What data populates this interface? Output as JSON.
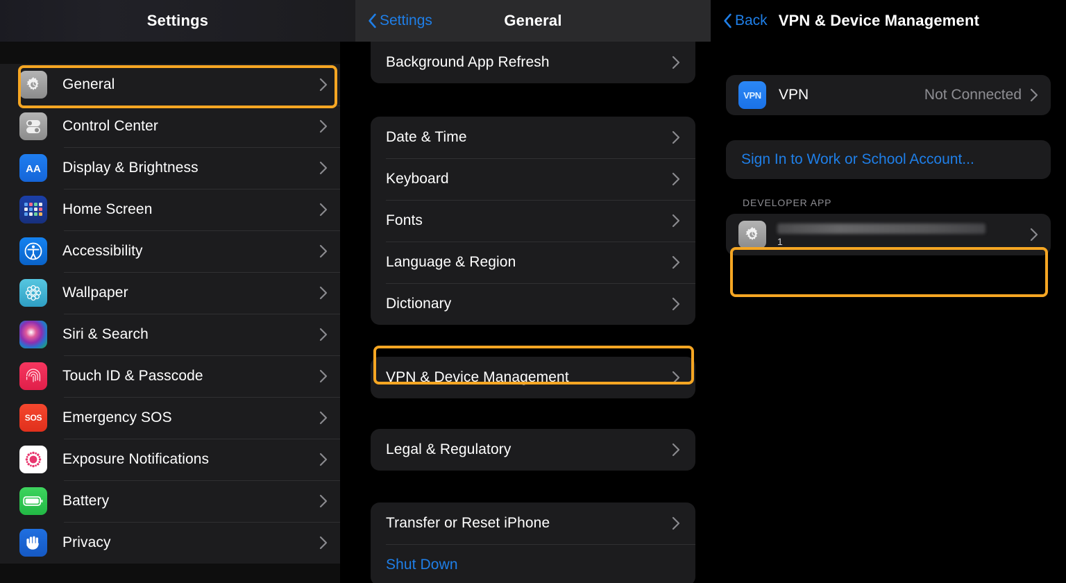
{
  "sidebar": {
    "title": "Settings",
    "items": [
      {
        "label": "General",
        "icon": "gear-icon",
        "icon_class": "ic-gear",
        "highlighted": true
      },
      {
        "label": "Control Center",
        "icon": "control-center-icon",
        "icon_class": "ic-cc",
        "highlighted": false
      },
      {
        "label": "Display & Brightness",
        "icon": "display-brightness-icon",
        "icon_class": "ic-aa",
        "highlighted": false
      },
      {
        "label": "Home Screen",
        "icon": "home-screen-icon",
        "icon_class": "ic-home",
        "highlighted": false
      },
      {
        "label": "Accessibility",
        "icon": "accessibility-icon",
        "icon_class": "ic-access",
        "highlighted": false
      },
      {
        "label": "Wallpaper",
        "icon": "wallpaper-icon",
        "icon_class": "ic-wall",
        "highlighted": false
      },
      {
        "label": "Siri & Search",
        "icon": "siri-icon",
        "icon_class": "ic-siri",
        "highlighted": false
      },
      {
        "label": "Touch ID & Passcode",
        "icon": "touch-id-icon",
        "icon_class": "ic-touch",
        "highlighted": false
      },
      {
        "label": "Emergency SOS",
        "icon": "emergency-sos-icon",
        "icon_class": "ic-sos",
        "highlighted": false
      },
      {
        "label": "Exposure Notifications",
        "icon": "exposure-notifications-icon",
        "icon_class": "ic-exp",
        "highlighted": false
      },
      {
        "label": "Battery",
        "icon": "battery-icon",
        "icon_class": "ic-bat",
        "highlighted": false
      },
      {
        "label": "Privacy",
        "icon": "privacy-icon",
        "icon_class": "ic-priv",
        "highlighted": false
      }
    ]
  },
  "middle": {
    "back_label": "Settings",
    "title": "General",
    "group_partial": [
      {
        "label": "Background App Refresh",
        "style": "default"
      }
    ],
    "group_localization": [
      {
        "label": "Date & Time",
        "style": "default"
      },
      {
        "label": "Keyboard",
        "style": "default"
      },
      {
        "label": "Fonts",
        "style": "default"
      },
      {
        "label": "Language & Region",
        "style": "default"
      },
      {
        "label": "Dictionary",
        "style": "default"
      }
    ],
    "group_vpn": [
      {
        "label": "VPN & Device Management",
        "style": "default",
        "highlighted": true
      }
    ],
    "group_legal": [
      {
        "label": "Legal & Regulatory",
        "style": "default"
      }
    ],
    "group_reset": [
      {
        "label": "Transfer or Reset iPhone",
        "style": "default"
      },
      {
        "label": "Shut Down",
        "style": "blue"
      }
    ]
  },
  "detail": {
    "back_label": "Back",
    "title": "VPN & Device Management",
    "vpn_row": {
      "icon_text": "VPN",
      "label": "VPN",
      "value": "Not Connected"
    },
    "sign_in_label": "Sign In to Work or School Account...",
    "section_header": "DEVELOPER APP",
    "developer_app": {
      "icon": "gear-icon",
      "name_redacted": true,
      "name": "",
      "subtitle": "1",
      "highlighted": true
    }
  },
  "colors": {
    "highlight": "#f5a623",
    "accent_blue": "#1f7fe8",
    "card_bg": "#1c1c1e",
    "page_bg": "#000000",
    "secondary_text": "#8e8e93"
  }
}
